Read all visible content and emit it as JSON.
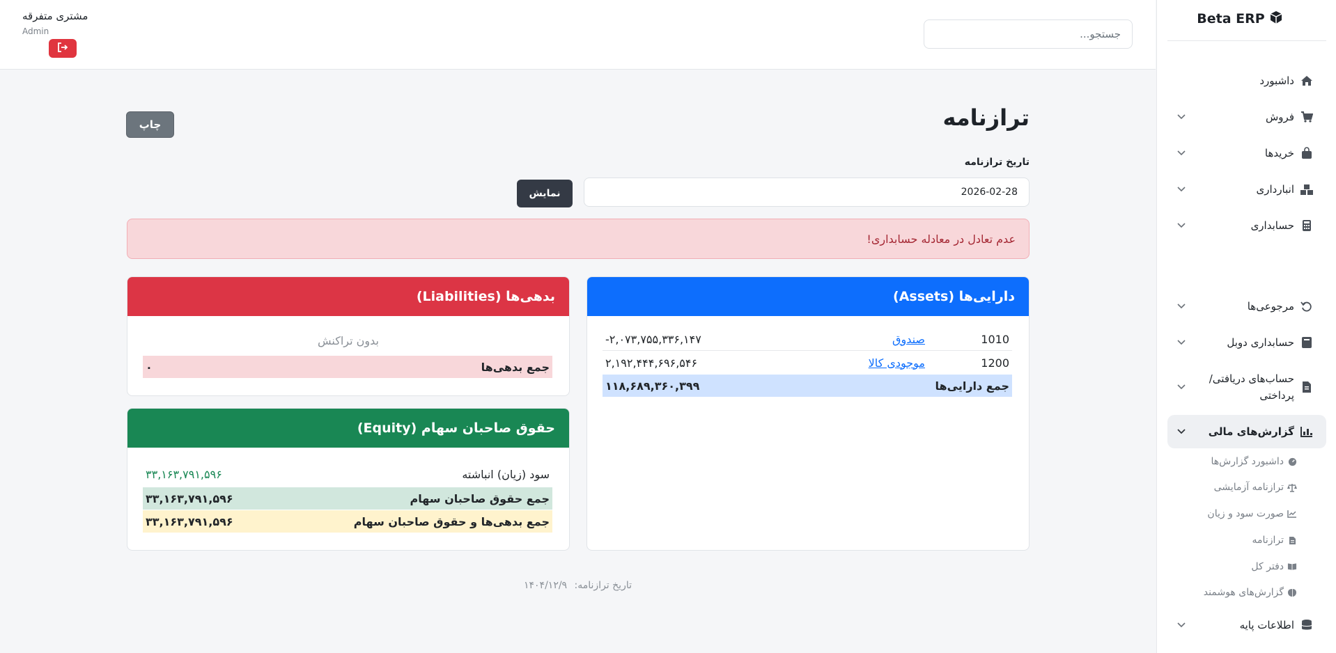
{
  "sidebar": {
    "brand": "Beta ERP",
    "items": [
      {
        "label": "داشبورد",
        "icon": "home-icon"
      },
      {
        "label": "فروش",
        "icon": "cart-icon"
      },
      {
        "label": "خریدها",
        "icon": "bag-icon"
      },
      {
        "label": "انبارداری",
        "icon": "boxes-icon"
      },
      {
        "label": "حسابداری",
        "icon": "calculator-icon"
      },
      {
        "label": "مرجوعی‌ها",
        "icon": "undo-icon"
      },
      {
        "label": "حسابداری دوبل",
        "icon": "book-icon"
      },
      {
        "label": "حساب‌های دریافتی/ پرداختی",
        "icon": "invoice-icon"
      },
      {
        "label": "گزارش‌های مالی",
        "icon": "chart-icon"
      },
      {
        "label": "اطلاعات پایه",
        "icon": "database-icon"
      }
    ],
    "sub_items": [
      {
        "label": "داشبورد گزارش‌ها",
        "icon": "gauge-icon"
      },
      {
        "label": "ترازنامه آزمایشی",
        "icon": "scale-icon"
      },
      {
        "label": "صورت سود و زیان",
        "icon": "line-chart-icon"
      },
      {
        "label": "ترازنامه",
        "icon": "file-icon"
      },
      {
        "label": "دفتر کل",
        "icon": "open-book-icon"
      },
      {
        "label": "گزارش‌های هوشمند",
        "icon": "brain-icon"
      }
    ]
  },
  "topbar": {
    "search_placeholder": "جستجو...",
    "user_name": "مشتری متفرقه",
    "user_role": "Admin"
  },
  "page": {
    "title": "ترازنامه",
    "print_label": "چاپ",
    "date_label": "تاریخ ترازنامه",
    "date_value": "2026-02-28",
    "show_label": "نمایش",
    "alert": "عدم تعادل در معادله حسابداری!"
  },
  "assets": {
    "title": "دارایی‌ها (Assets)",
    "rows": [
      {
        "code": "1010",
        "name": "صندوق",
        "amount": "-۲,۰۷۳,۷۵۵,۳۳۶,۱۴۷"
      },
      {
        "code": "1200",
        "name": "موجودی کالا",
        "amount": "۲,۱۹۲,۴۴۴,۶۹۶,۵۴۶"
      }
    ],
    "total_label": "جمع دارایی‌ها",
    "total_amount": "۱۱۸,۶۸۹,۳۶۰,۳۹۹"
  },
  "liabilities": {
    "title": "بدهی‌ها (Liabilities)",
    "empty": "بدون تراکنش",
    "total_label": "جمع بدهی‌ها",
    "total_amount": "۰"
  },
  "equity": {
    "title": "حقوق صاحبان سهام (Equity)",
    "retained_label": "سود (زیان) انباشته",
    "retained_amount": "۳۳,۱۶۳,۷۹۱,۵۹۶",
    "total_label": "جمع حقوق صاحبان سهام",
    "total_amount": "۳۳,۱۶۳,۷۹۱,۵۹۶",
    "grand_label": "جمع بدهی‌ها و حقوق صاحبان سهام",
    "grand_amount": "۳۳,۱۶۳,۷۹۱,۵۹۶"
  },
  "footer": {
    "label": "تاریخ ترازنامه:",
    "date": "۱۴۰۴/۱۲/۹"
  },
  "colors": {
    "assets_header": "#0d6efd",
    "liabilities_header": "#dc3545",
    "equity_header": "#198754",
    "alert_bg": "#f8d7da",
    "assets_total_bg": "#cfe2ff",
    "liabilities_total_bg": "#f8d7da",
    "equity_total_bg": "#d1e7dd",
    "grand_total_bg": "#fff3cd",
    "positive_amount": "#198754"
  }
}
